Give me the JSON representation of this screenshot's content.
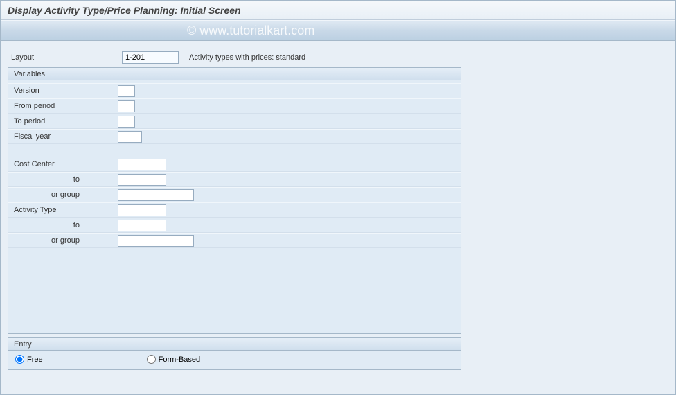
{
  "header": {
    "title": "Display Activity Type/Price Planning: Initial Screen"
  },
  "watermark": "© www.tutorialkart.com",
  "layout": {
    "label": "Layout",
    "value": "1-201",
    "description": "Activity types with prices: standard"
  },
  "variables": {
    "panel_title": "Variables",
    "fields": {
      "version": {
        "label": "Version",
        "value": ""
      },
      "from_period": {
        "label": "From period",
        "value": ""
      },
      "to_period": {
        "label": "To period",
        "value": ""
      },
      "fiscal_year": {
        "label": "Fiscal year",
        "value": ""
      },
      "cost_center": {
        "label": "Cost Center",
        "value": ""
      },
      "cost_center_to": {
        "label": "to",
        "value": ""
      },
      "cost_center_group": {
        "label": "or group",
        "value": ""
      },
      "activity_type": {
        "label": "Activity Type",
        "value": ""
      },
      "activity_type_to": {
        "label": "to",
        "value": ""
      },
      "activity_type_group": {
        "label": "or group",
        "value": ""
      }
    }
  },
  "entry": {
    "panel_title": "Entry",
    "options": {
      "free": {
        "label": "Free",
        "selected": true
      },
      "form_based": {
        "label": "Form-Based",
        "selected": false
      }
    }
  }
}
